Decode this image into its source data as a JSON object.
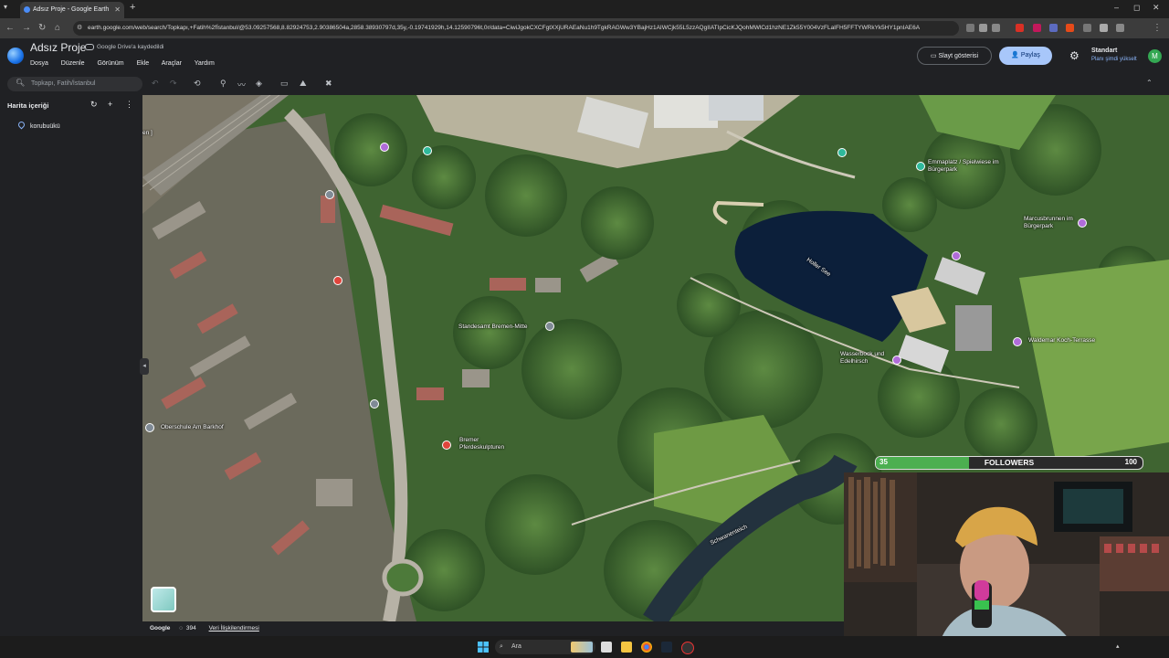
{
  "browser": {
    "tab_title": "Adsız Proje - Google Earth",
    "url": "earth.google.com/web/search/Topkapı,+Fatih%2fİstanbul/@53.09257568,8.82924753,2.90386504a,2858.38930797d,35y,-0.19741929h,14.12590796t,0r/data=CiwiJgokCXCFgtXXjURAEaNu1h9TgkRAGWw3YBajHz1AIWCjk55L5zzAQgIIATIpCicKJQohMWlCd1hzNE1Zk55Y004VzFLaIFH5FFTYWRkYk5HY1pnIAE6A"
  },
  "app": {
    "title": "Adsız Proje",
    "save_status": "Google Drive'a kaydedildi",
    "menus": [
      "Dosya",
      "Düzenle",
      "Görünüm",
      "Ekle",
      "Araçlar",
      "Yardım"
    ],
    "slideshow_label": "Slayt gösterisi",
    "share_label": "Paylaş",
    "plan_name": "Standart",
    "plan_upgrade": "Planı şimdi yükselt",
    "avatar_initial": "M"
  },
  "toolbar": {
    "search_placeholder": "Topkapı, Fatih/İstanbul"
  },
  "sidebar": {
    "title": "Harita içeriği",
    "items": [
      "korubuükü"
    ]
  },
  "map": {
    "labels": {
      "lake": "Holler See",
      "standesamt": "Standesamt Bremen-Mitte",
      "oberschule": "Oberschule Am Barkhof",
      "pferdeskulptur": "Bremer Pferdeskulpturen",
      "wasserbock": "Wasserbock und Edelhirsch",
      "waldemar": "Waldemar Koch-Terrasse",
      "marcus": "Marcusbrunnen im Bürgerpark",
      "spielwiese": "Emmaplatz / Spielwiese im Bürgerpark",
      "schwanen": "Schwanenteich",
      "edge": "en ]"
    },
    "footer_brand": "Google",
    "footer_value": "394",
    "footer_link": "Veri İlişkilendirmesi"
  },
  "overlay": {
    "followers_current": "35",
    "followers_label": "FOLLOWERS",
    "followers_goal": "100",
    "followers_progress": 0.35
  },
  "taskbar": {
    "search_label": "Ara"
  },
  "colors": {
    "accent": "#a8c7fa",
    "progress": "#4caf50",
    "background": "#202124"
  }
}
